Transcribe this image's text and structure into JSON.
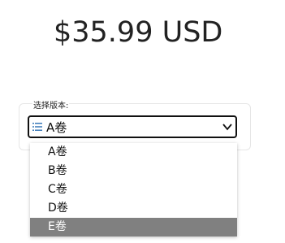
{
  "price": {
    "text": "$35.99 USD"
  },
  "version_picker": {
    "label": "选择版本:",
    "selected_value": "A卷",
    "icon": "list-icon",
    "options": [
      {
        "label": "A卷",
        "highlighted": false
      },
      {
        "label": "B卷",
        "highlighted": false
      },
      {
        "label": "C卷",
        "highlighted": false
      },
      {
        "label": "D卷",
        "highlighted": false
      },
      {
        "label": "E卷",
        "highlighted": true
      }
    ]
  },
  "colors": {
    "text": "#222222",
    "select_border": "#111111",
    "list_icon": "#3a79b8",
    "highlight_bg": "#808080",
    "highlight_text": "#ffffff"
  }
}
